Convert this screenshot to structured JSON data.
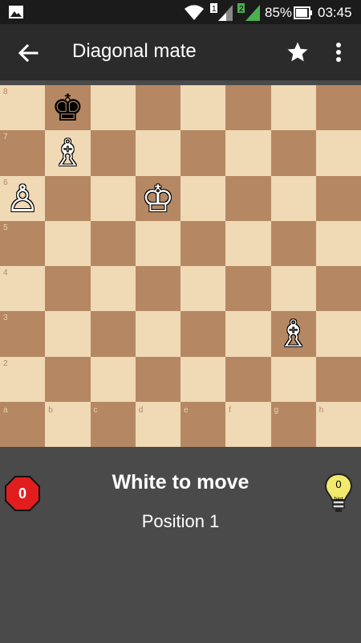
{
  "status_bar": {
    "battery": "85%",
    "time": "03:45",
    "sim1": "1",
    "sim2": "2"
  },
  "app_bar": {
    "title": "Diagonal mate",
    "icons": [
      "back-arrow-icon",
      "star-icon",
      "more-vert-icon"
    ]
  },
  "board": {
    "files": [
      "a",
      "b",
      "c",
      "d",
      "e",
      "f",
      "g",
      "h"
    ],
    "ranks": [
      "8",
      "7",
      "6",
      "5",
      "4",
      "3",
      "2"
    ],
    "pieces": [
      {
        "square": "b8",
        "glyph": "♚",
        "side": "black",
        "name": "black-king"
      },
      {
        "square": "b7",
        "glyph": "♗",
        "side": "white",
        "name": "white-bishop"
      },
      {
        "square": "a6",
        "glyph": "♙",
        "side": "white",
        "name": "white-pawn"
      },
      {
        "square": "d6",
        "glyph": "♔",
        "side": "white",
        "name": "white-king"
      },
      {
        "square": "g3",
        "glyph": "♗",
        "side": "white",
        "name": "white-bishop"
      }
    ]
  },
  "panel": {
    "mistakes": "0",
    "to_move": "White to move",
    "position": "Position 1",
    "hints": "0",
    "hint_label": "hint"
  },
  "colors": {
    "light_square": "#f0d9b5",
    "dark_square": "#b58863",
    "stop_red": "#e11d1d",
    "hint_yellow": "#f2ea6d"
  }
}
